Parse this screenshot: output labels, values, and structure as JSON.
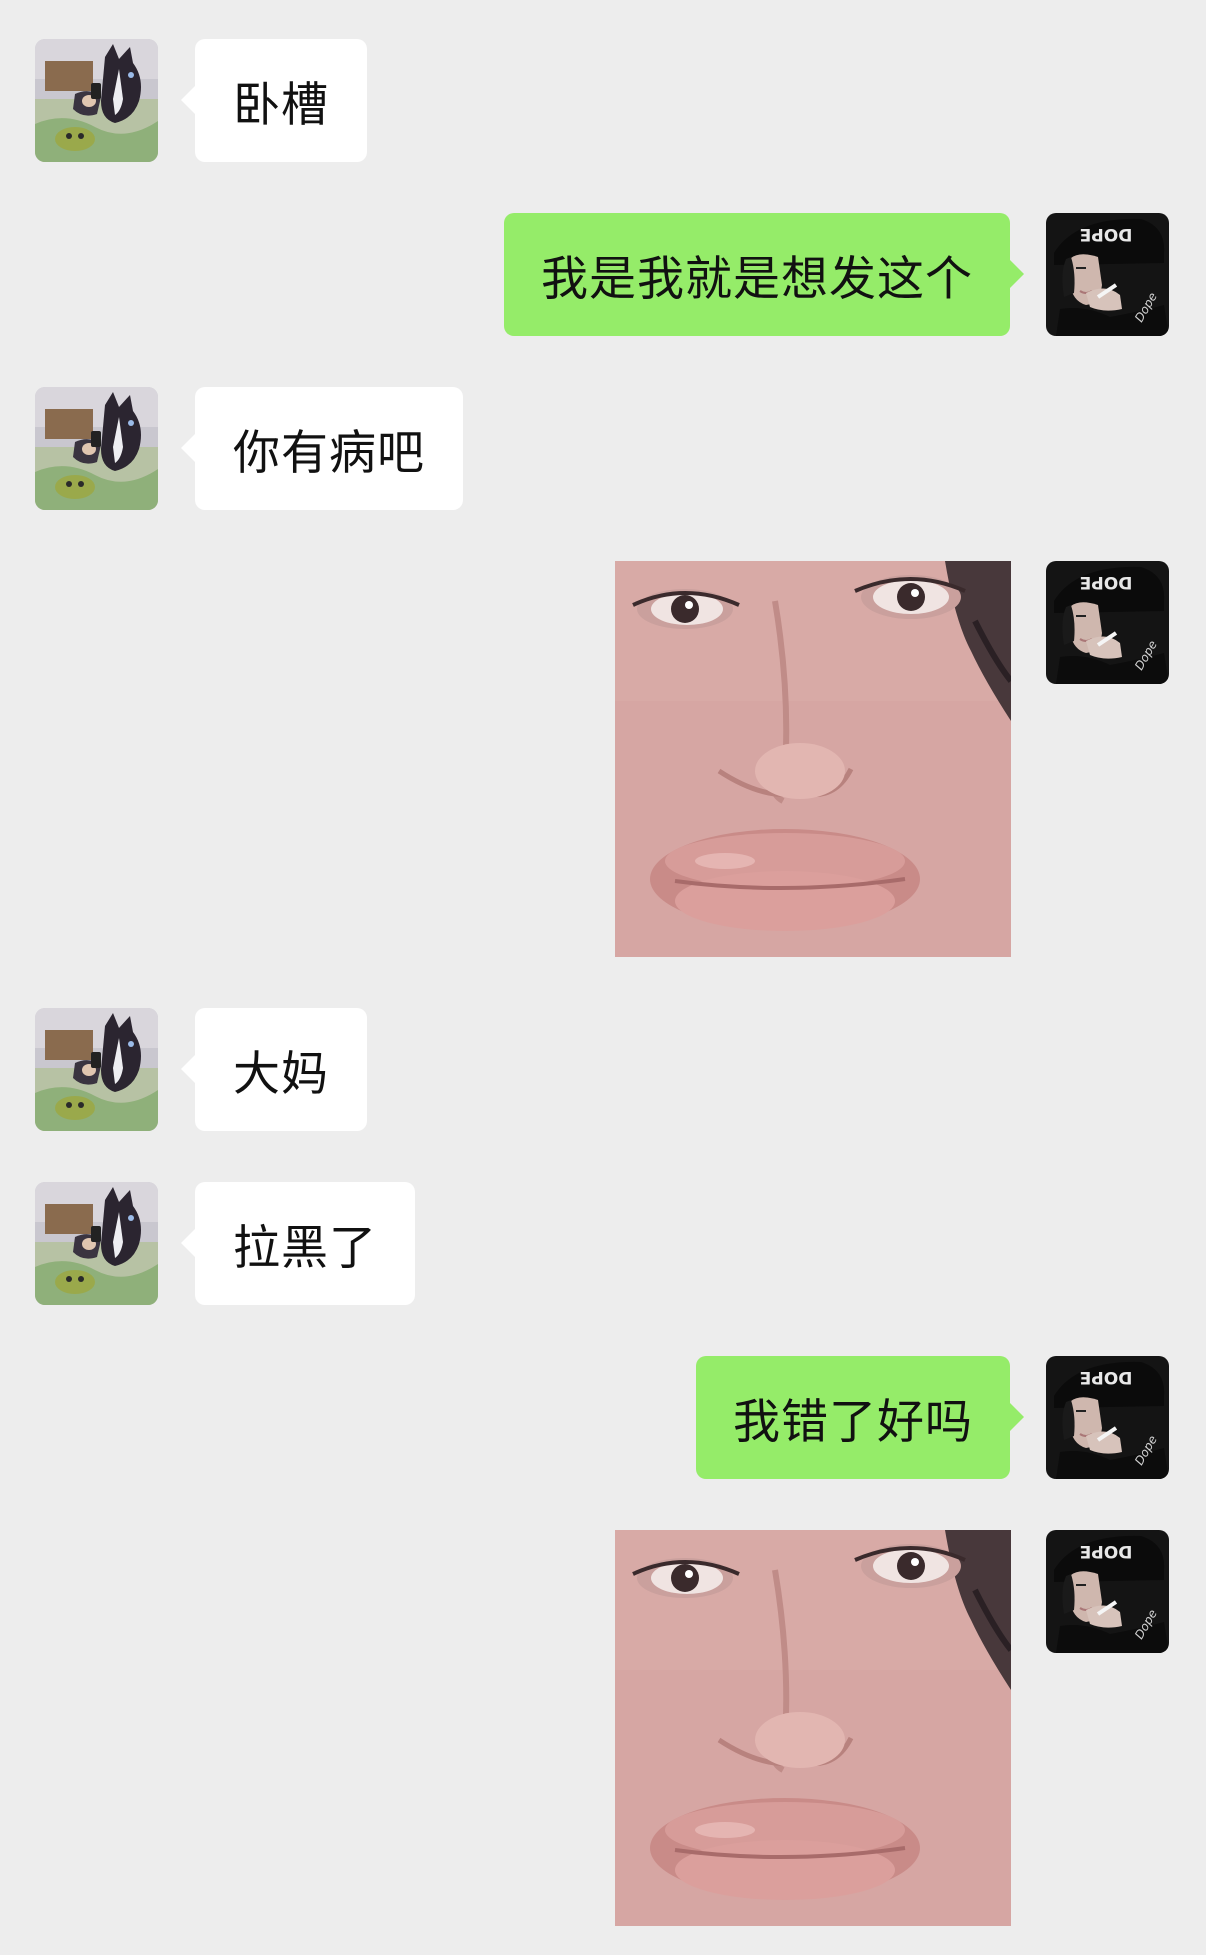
{
  "chat": {
    "messages": [
      {
        "id": "m1",
        "side": "incoming",
        "type": "text",
        "text": "卧槽",
        "avatar": "horse-mask-avatar"
      },
      {
        "id": "m2",
        "side": "outgoing",
        "type": "text",
        "text": "我是我就是想发这个",
        "avatar": "dope-cap-avatar"
      },
      {
        "id": "m3",
        "side": "incoming",
        "type": "text",
        "text": "你有病吧",
        "avatar": "horse-mask-avatar"
      },
      {
        "id": "m4",
        "side": "outgoing",
        "type": "image",
        "image": "face-closeup-sticker",
        "avatar": "dope-cap-avatar"
      },
      {
        "id": "m5",
        "side": "incoming",
        "type": "text",
        "text": "大妈",
        "avatar": "horse-mask-avatar"
      },
      {
        "id": "m6",
        "side": "incoming",
        "type": "text",
        "text": "拉黑了",
        "avatar": "horse-mask-avatar"
      },
      {
        "id": "m7",
        "side": "outgoing",
        "type": "text",
        "text": "我错了好吗",
        "avatar": "dope-cap-avatar"
      },
      {
        "id": "m8",
        "side": "outgoing",
        "type": "image",
        "image": "face-closeup-sticker",
        "avatar": "dope-cap-avatar"
      }
    ],
    "avatar_cap_text": "DOPE"
  },
  "colors": {
    "background": "#ededed",
    "incoming_bubble": "#ffffff",
    "outgoing_bubble": "#95ec69",
    "text": "#111111"
  }
}
